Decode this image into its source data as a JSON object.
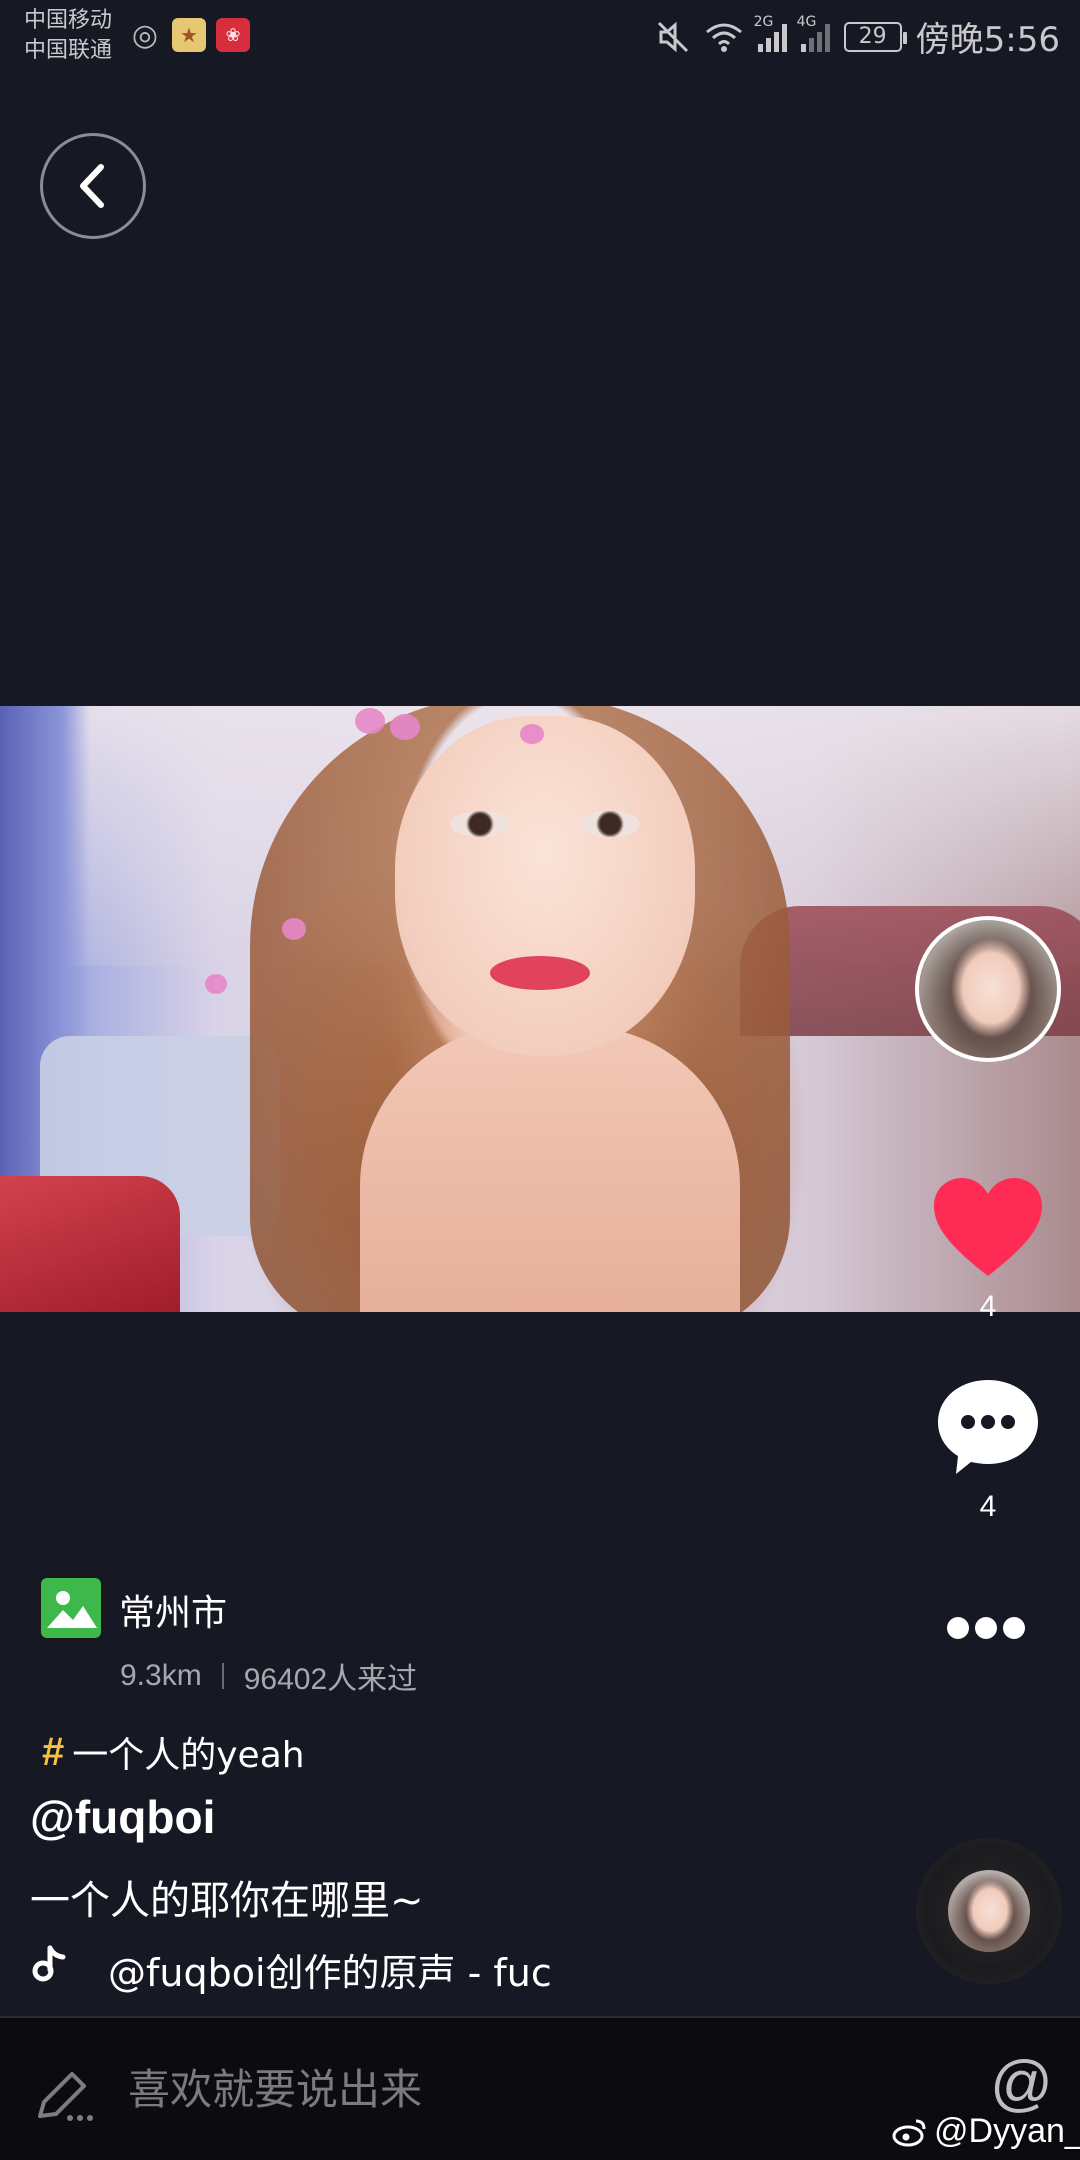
{
  "status_bar": {
    "carrier_1": "中国移动",
    "carrier_2": "中国联通",
    "network_1": "2G",
    "network_2": "4G",
    "battery": "29",
    "time": "傍晚5:56"
  },
  "location": {
    "name": "常州市",
    "distance": "9.3km",
    "visitors": "96402人来过"
  },
  "post": {
    "hashtag": "一个人的yeah",
    "username": "@fuqboi",
    "caption": "一个人的耶你在哪里~",
    "music": "@fuqboi创作的原声 - fuc"
  },
  "actions": {
    "likes": "4",
    "comments": "4"
  },
  "comment_bar": {
    "placeholder": "喜欢就要说出来",
    "at_symbol": "@"
  },
  "watermark": "@Dyyan_",
  "colors": {
    "background": "#161823",
    "like_red": "#fe2c55",
    "hashtag_yellow": "#f6c341",
    "location_green": "#3fb84b"
  },
  "icons": [
    "back-icon",
    "heart-icon",
    "comment-icon",
    "more-icon",
    "image-icon",
    "music-note-icon",
    "pen-icon",
    "weibo-icon"
  ]
}
